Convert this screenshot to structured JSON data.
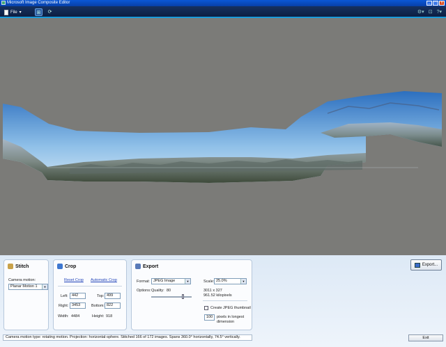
{
  "window": {
    "title": "Microsoft Image Composite Editor"
  },
  "toolbar": {
    "file_label": "File"
  },
  "stitch": {
    "title": "Stitch",
    "camera_motion_label": "Camera motion:",
    "camera_motion_value": "Planar Motion 1"
  },
  "crop": {
    "title": "Crop",
    "reset_label": "Reset Crop",
    "automatic_label": "Automatic Crop",
    "left_label": "Left:",
    "left_value": "442",
    "top_label": "Top:",
    "top_value": "499",
    "right_label": "Right:",
    "right_value": "3453",
    "bottom_label": "Bottom:",
    "bottom_value": "822",
    "width_label": "Width:",
    "width_value": "4484",
    "height_label": "Height:",
    "height_value": "918"
  },
  "export": {
    "title": "Export",
    "format_label": "Format:",
    "format_value": "JPEG Image",
    "options_label": "Options:",
    "quality_label": "Quality:",
    "quality_value": "80",
    "scale_label": "Scale:",
    "scale_value": "25.0%",
    "dimensions": "3011 x 327",
    "kilopixels": "961.52 kilopixels",
    "thumbnail_label": "Create JPEG thumbnail",
    "thumbnail_size": "100",
    "pixels_label_1": "pixels in longest",
    "pixels_label_2": "dimension",
    "button_label": "Export..."
  },
  "status": {
    "text": "Camera motion type: rotating motion. Projection: horizontal-sphere. Stitched 166 of 172 images. Spans 360.0° horizontally, 74.5° vertically.",
    "exit_label": "Exit"
  },
  "colors": {
    "accent": "#1a9ad8",
    "titlebar": "#0a57d6"
  }
}
